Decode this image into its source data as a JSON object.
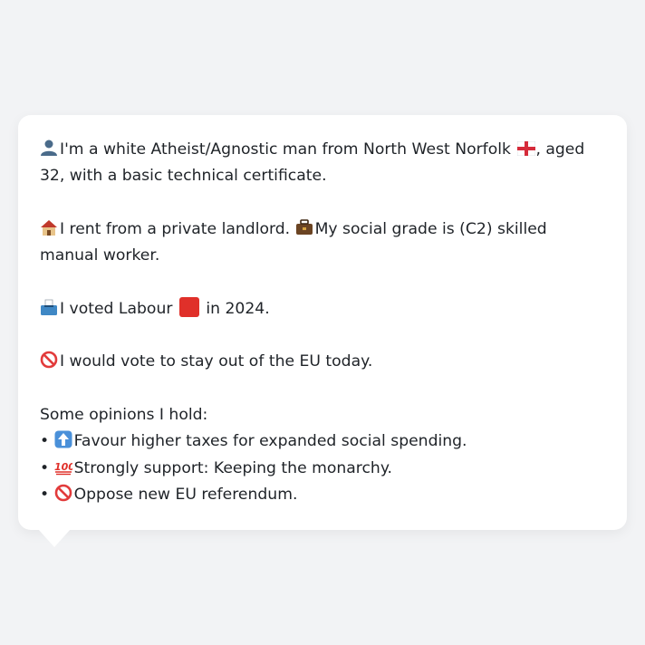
{
  "profile": {
    "intro": {
      "icon": "person-silhouette-icon",
      "text_before_flag": "I'm a white Atheist/Agnostic man from North West Norfolk",
      "flag_icon": "england-flag-icon",
      "text_after_flag": ", aged 32, with a basic technical certificate."
    },
    "housing": {
      "icon": "house-icon",
      "text": "I rent from a private landlord.",
      "grade_icon": "briefcase-icon",
      "grade_text": "My social grade is (C2) skilled manual worker."
    },
    "vote": {
      "icon": "ballot-box-icon",
      "text_before": "I voted Labour",
      "party_icon": "red-square-icon",
      "party_color": "#e0302a",
      "text_after": "in 2024."
    },
    "eu": {
      "icon": "prohibited-icon",
      "text": "I would vote to stay out of the EU today."
    },
    "opinions": {
      "heading": "Some opinions I hold:",
      "items": [
        {
          "bullet": "•",
          "icon": "up-arrow-icon",
          "text": "Favour higher taxes for expanded social spending."
        },
        {
          "bullet": "•",
          "icon": "hundred-points-icon",
          "text": "Strongly support: Keeping the monarchy."
        },
        {
          "bullet": "•",
          "icon": "prohibited-icon",
          "text": "Oppose new EU referendum."
        }
      ]
    }
  },
  "colors": {
    "background": "#f2f3f5",
    "card": "#ffffff",
    "text": "#1f2328"
  }
}
